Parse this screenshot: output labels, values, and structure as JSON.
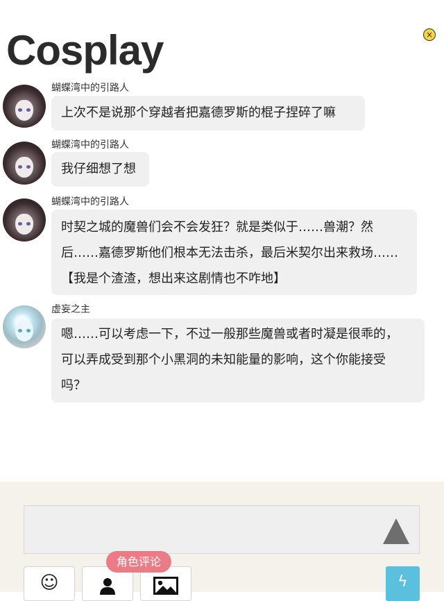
{
  "header": {
    "title": "Cosplay",
    "close_icon": "×"
  },
  "messages": [
    {
      "author": "蝴蝶湾中的引路人",
      "avatar": "girl-avatar",
      "lines": [
        "上次不是说那个穿越者把嘉德罗斯的棍子捏碎了嘛"
      ]
    },
    {
      "author": "蝴蝶湾中的引路人",
      "avatar": "girl-avatar",
      "lines": [
        "我仔细想了想"
      ]
    },
    {
      "author": "蝴蝶湾中的引路人",
      "avatar": "girl-avatar",
      "lines": [
        "时契之城的魔兽们会不会发狂？就是类似于……兽潮？然",
        "后……嘉德罗斯他们根本无法击杀，最后米契尔出来救场……",
        "【我是个渣渣，想出来这剧情也不咋地】"
      ]
    },
    {
      "author": "虚妄之主",
      "avatar": "ghost-avatar",
      "lines": [
        "嗯……可以考虑一下，不过一般那些魔兽或者时凝是很乖的，",
        "可以弄成受到那个小黑洞的未知能量的影响，这个你能接受",
        "吗？"
      ]
    }
  ],
  "composer": {
    "input_value": "",
    "role_comment_label": "角色评论",
    "emoji_icon": "☺",
    "send_icon": "up-triangle-icon",
    "flash_icon": "ϟ"
  },
  "colors": {
    "bubble": "#f0f0f0",
    "tip": "#ea7b87",
    "flash": "#5bc0de",
    "composer_bg": "#f4f2ea"
  }
}
